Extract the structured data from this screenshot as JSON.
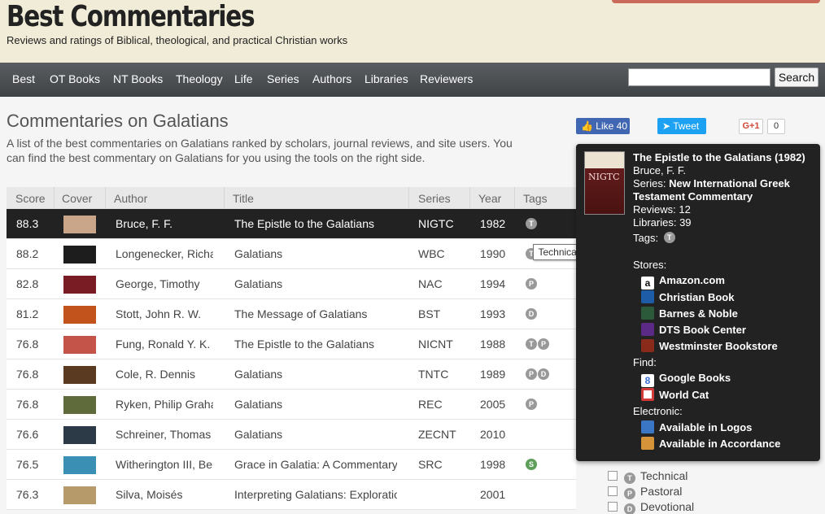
{
  "header": {
    "logo": "Best Commentaries",
    "tagline": "Reviews and ratings of Biblical, theological, and practical Christian works"
  },
  "nav": {
    "items": [
      "Best",
      "OT Books",
      "NT Books",
      "Theology",
      "Life",
      "Series",
      "Authors",
      "Libraries",
      "Reviewers"
    ],
    "search_value": "",
    "search_button": "Search"
  },
  "page": {
    "title": "Commentaries on Galatians",
    "intro": "A list of the best commentaries on Galatians ranked by scholars, journal reviews, and site users. You can find the best commentary on Galatians for you using the tools on the right side."
  },
  "social": {
    "like": "Like 40",
    "tweet": "Tweet",
    "gplus": "G+1",
    "gplus_count": "0"
  },
  "table": {
    "headers": [
      "Score",
      "Cover",
      "Author",
      "Title",
      "Series",
      "Year",
      "Tags"
    ],
    "rows": [
      {
        "score": "88.3",
        "author": "Bruce, F. F.",
        "title": "The Epistle to the Galatians",
        "series": "NIGTC",
        "year": "1982",
        "tags": [
          "T"
        ],
        "cover": "#c9a58a"
      },
      {
        "score": "88.2",
        "author": "Longenecker, Richard",
        "title": "Galatians",
        "series": "WBC",
        "year": "1990",
        "tags": [
          "T"
        ],
        "cover": "#1d1d1d"
      },
      {
        "score": "82.8",
        "author": "George, Timothy",
        "title": "Galatians",
        "series": "NAC",
        "year": "1994",
        "tags": [
          "P"
        ],
        "cover": "#7a1c24"
      },
      {
        "score": "81.2",
        "author": "Stott, John R. W.",
        "title": "The Message of Galatians",
        "series": "BST",
        "year": "1993",
        "tags": [
          "D"
        ],
        "cover": "#c2531c"
      },
      {
        "score": "76.8",
        "author": "Fung, Ronald Y. K.",
        "title": "The Epistle to the Galatians",
        "series": "NICNT",
        "year": "1988",
        "tags": [
          "T",
          "P"
        ],
        "cover": "#c4534a"
      },
      {
        "score": "76.8",
        "author": "Cole, R. Dennis",
        "title": "Galatians",
        "series": "TNTC",
        "year": "1989",
        "tags": [
          "P",
          "D"
        ],
        "cover": "#5a3a20"
      },
      {
        "score": "76.8",
        "author": "Ryken, Philip Graham",
        "title": "Galatians",
        "series": "REC",
        "year": "2005",
        "tags": [
          "P"
        ],
        "cover": "#5f6b3a"
      },
      {
        "score": "76.6",
        "author": "Schreiner, Thomas R.",
        "title": "Galatians",
        "series": "ZECNT",
        "year": "2010",
        "tags": [],
        "cover": "#2c3a48"
      },
      {
        "score": "76.5",
        "author": "Witherington III, Ben",
        "title": "Grace in Galatia: A Commentary on",
        "series": "SRC",
        "year": "1998",
        "tags": [
          "S"
        ],
        "cover": "#3a8fb5"
      },
      {
        "score": "76.3",
        "author": "Silva, Moisés",
        "title": "Interpreting Galatians: Explorations",
        "series": "",
        "year": "2001",
        "tags": [],
        "cover": "#b79a6a"
      }
    ]
  },
  "tooltip_small": "Technical",
  "popup": {
    "title": "The Epistle to the Galatians (1982)",
    "author": "Bruce, F. F.",
    "series_label": "Series:",
    "series_name_1": "New International Greek",
    "series_name_2": "Testament Commentary",
    "reviews": "Reviews: 12",
    "libraries": "Libraries: 39",
    "tags_label": "Tags:",
    "cover_band": "NIGTC",
    "stores_label": "Stores:",
    "stores": [
      "Amazon.com",
      "Christian Book",
      "Barnes & Noble",
      "DTS Book Center",
      "Westminster Bookstore"
    ],
    "find_label": "Find:",
    "find": [
      "Google Books",
      "World Cat"
    ],
    "electronic_label": "Electronic:",
    "electronic": [
      "Available in Logos",
      "Available in Accordance"
    ]
  },
  "filters": [
    {
      "tag": "T",
      "label": "Technical"
    },
    {
      "tag": "P",
      "label": "Pastoral"
    },
    {
      "tag": "D",
      "label": "Devotional"
    }
  ]
}
